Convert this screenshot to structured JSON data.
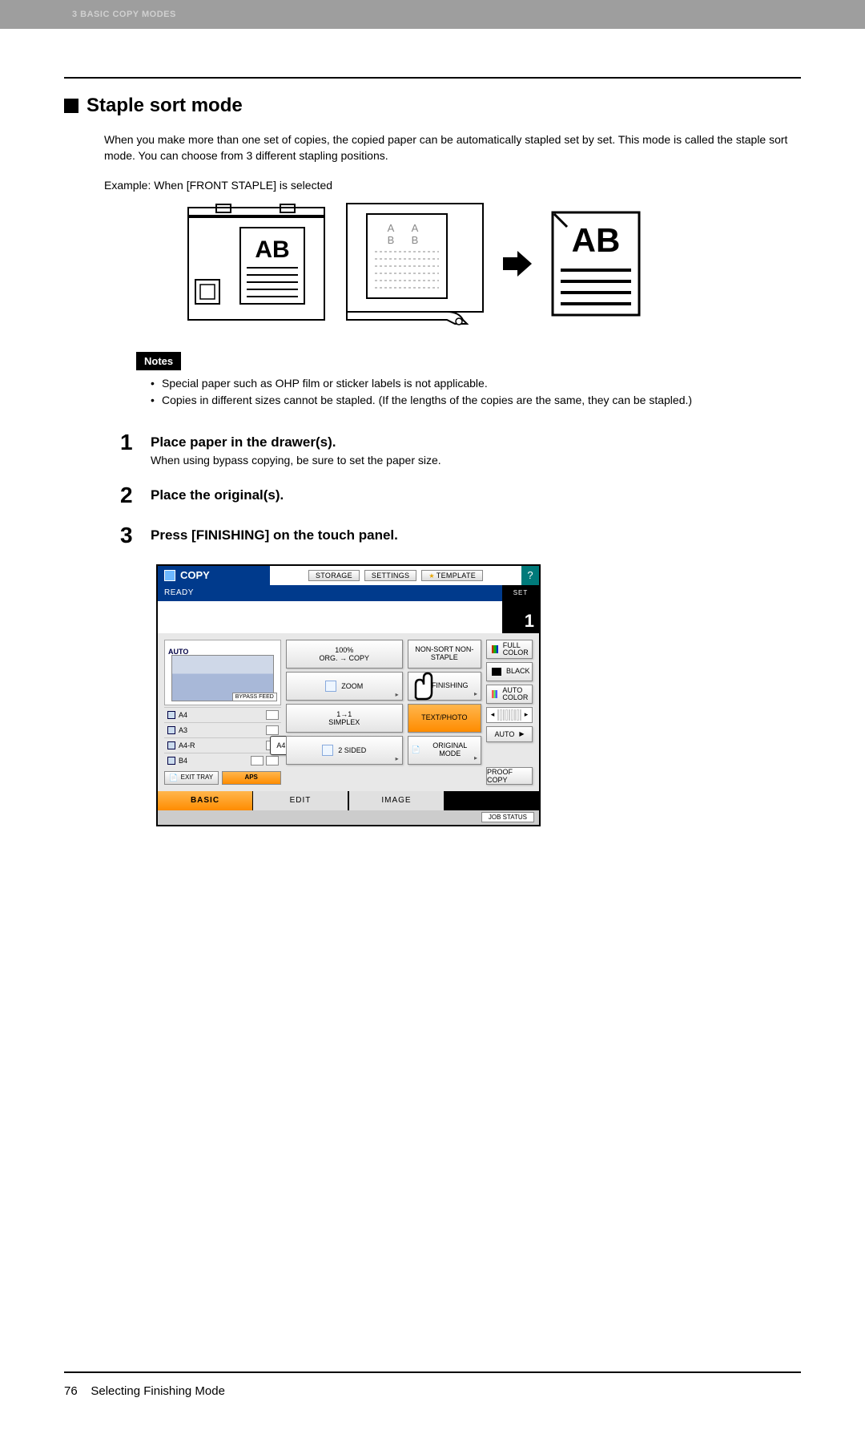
{
  "header": {
    "crumb": "3 BASIC COPY MODES"
  },
  "title": "Staple sort mode",
  "intro": "When you make more than one set of copies, the copied paper can be automatically stapled set by set. This mode is called the staple sort mode. You can choose from 3 different stapling positions.",
  "example": "Example: When [FRONT STAPLE] is selected",
  "diagram_label": "AB",
  "notes_label": "Notes",
  "notes": [
    "Special paper such as OHP film or sticker labels is not applicable.",
    "Copies in different sizes cannot be stapled. (If the lengths of the copies are the same, they can be stapled.)"
  ],
  "steps": [
    {
      "num": "1",
      "title": "Place paper in the drawer(s).",
      "sub": "When using bypass copying, be sure to set the paper size."
    },
    {
      "num": "2",
      "title": "Place the original(s).",
      "sub": ""
    },
    {
      "num": "3",
      "title": "Press [FINISHING] on the touch panel.",
      "sub": ""
    }
  ],
  "panel": {
    "copy": "COPY",
    "storage": "STORAGE",
    "settings": "SETTINGS",
    "template": "TEMPLATE",
    "help": "?",
    "ready": "READY",
    "set": "SET",
    "count": "1",
    "auto": "AUTO",
    "bypass": "BYPASS FEED",
    "sizes": [
      "A4",
      "A3",
      "A4-R",
      "B4"
    ],
    "a4_pill": "A4",
    "exit_tray": "EXIT TRAY",
    "aps": "APS",
    "pct": "100%",
    "org_copy": "ORG. → COPY",
    "zoom": "ZOOM",
    "simplex_a": "1→1",
    "simplex_b": "SIMPLEX",
    "twosided": "2 SIDED",
    "nonsort": "NON-SORT NON-STAPLE",
    "finishing": "FINISHING",
    "textphoto": "TEXT/PHOTO",
    "origmode": "ORIGINAL MODE",
    "fullcolor": "FULL COLOR",
    "black": "BLACK",
    "autocolor": "AUTO COLOR",
    "auto_density": "AUTO",
    "proof": "PROOF COPY",
    "tab_basic": "BASIC",
    "tab_edit": "EDIT",
    "tab_image": "IMAGE",
    "jobstatus": "JOB STATUS"
  },
  "footer": {
    "page": "76",
    "section": "Selecting Finishing Mode"
  }
}
